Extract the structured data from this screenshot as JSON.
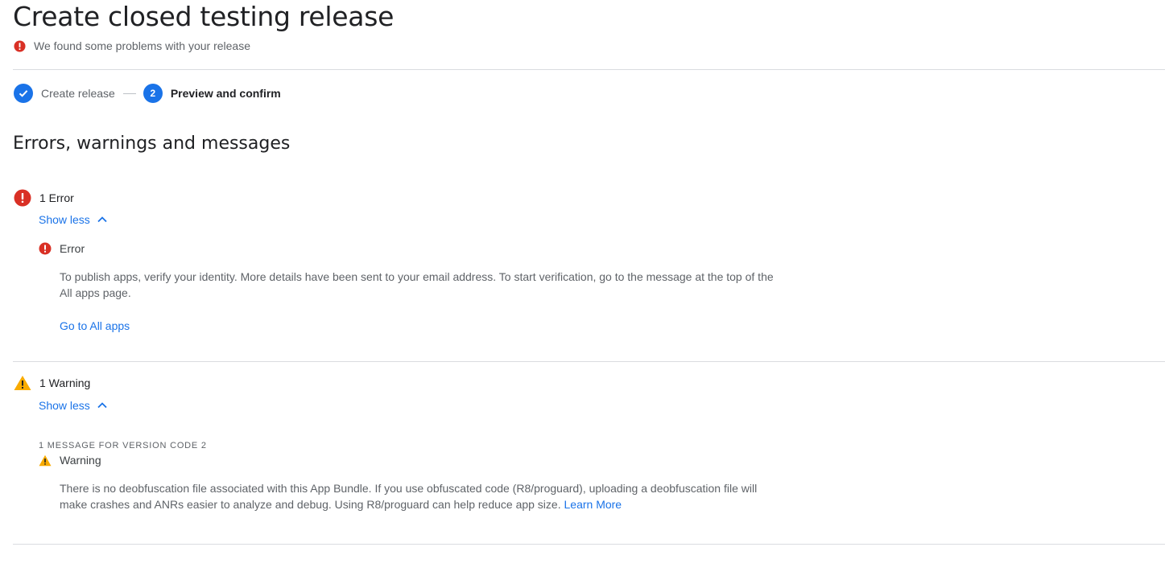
{
  "header": {
    "title": "Create closed testing release",
    "problem_text": "We found some problems with your release"
  },
  "stepper": {
    "steps": [
      {
        "number": "1",
        "label": "Create release",
        "state": "complete"
      },
      {
        "number": "2",
        "label": "Preview and confirm",
        "state": "active"
      }
    ]
  },
  "section": {
    "title": "Errors, warnings and messages"
  },
  "errors": {
    "summary": "1 Error",
    "toggle_label": "Show less",
    "item": {
      "title": "Error",
      "message": "To publish apps, verify your identity. More details have been sent to your email address. To start verification, go to the message at the top of the All apps page.",
      "action_label": "Go to All apps"
    }
  },
  "warnings": {
    "summary": "1 Warning",
    "toggle_label": "Show less",
    "version_label": "1 MESSAGE FOR VERSION CODE 2",
    "item": {
      "title": "Warning",
      "message": "There is no deobfuscation file associated with this App Bundle. If you use obfuscated code (R8/proguard), uploading a deobfuscation file will make crashes and ANRs easier to analyze and debug. Using R8/proguard can help reduce app size.",
      "link_label": "Learn More"
    }
  },
  "colors": {
    "accent": "#1a73e8",
    "error": "#d93025",
    "warning": "#f9ab00",
    "text_primary": "#202124",
    "text_secondary": "#5f6368",
    "divider": "#dadce0"
  },
  "icons": {
    "problem": "error-icon",
    "step_done": "check-icon",
    "error": "error-icon",
    "warning": "warning-icon",
    "toggle": "chevron-up-icon"
  }
}
